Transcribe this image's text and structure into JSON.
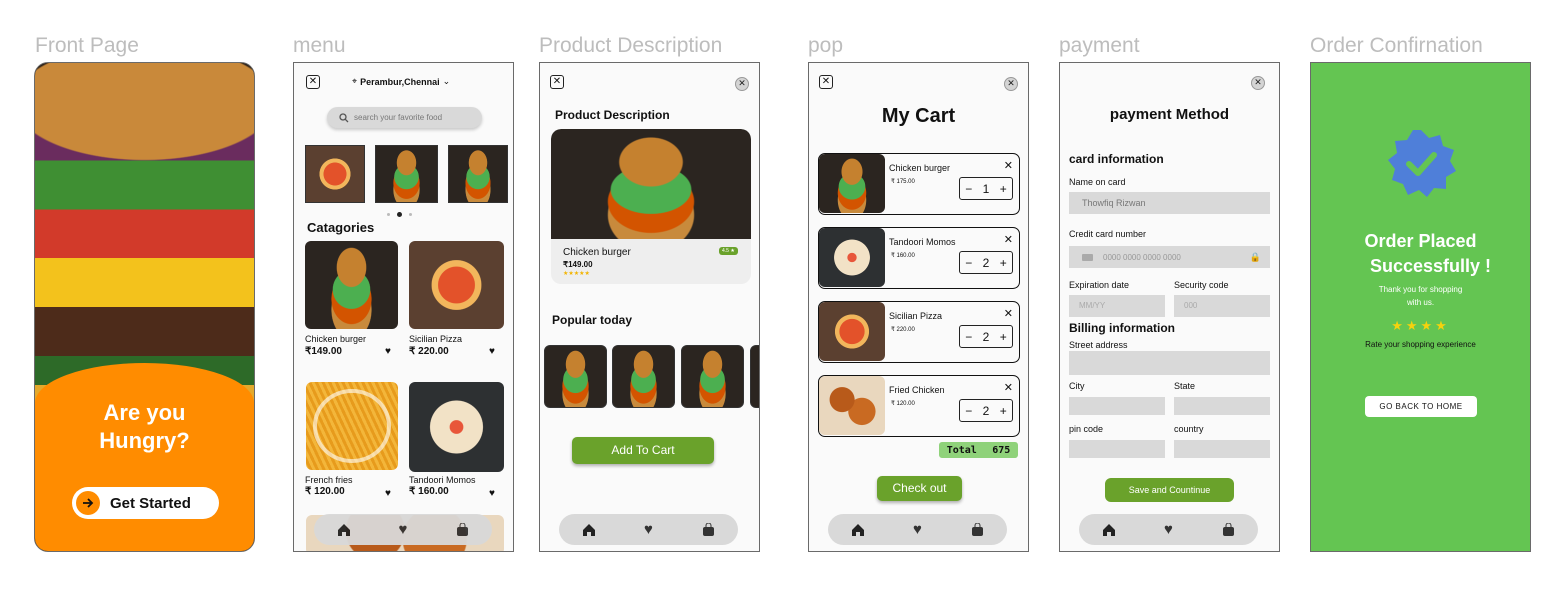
{
  "frames": {
    "front": "Front Page",
    "menu": "menu",
    "product": "Product Description",
    "pop": "pop",
    "payment": "payment",
    "order": "Order Confirnation"
  },
  "front_page": {
    "headline_line1": "Are you",
    "headline_line2": "Hungry?",
    "cta": "Get Started",
    "accent": "#ff8c00"
  },
  "menu": {
    "location": "Perambur,Chennai",
    "search_placeholder": "search your favorite food",
    "categories_title": "Catagories",
    "items": [
      {
        "name": "Chicken burger",
        "price": "₹149.00"
      },
      {
        "name": "Sicilian Pizza",
        "price": "₹ 220.00"
      },
      {
        "name": "French fries",
        "price": "₹ 120.00"
      },
      {
        "name": "Tandoori Momos",
        "price": "₹ 160.00"
      }
    ]
  },
  "product": {
    "title": "Product Description",
    "item_name": "Chicken burger",
    "item_price": "₹149.00",
    "rating_badge": "4.5 ★",
    "popular_title": "Popular today",
    "add_button": "Add To Cart",
    "accent": "#6aa22b"
  },
  "cart": {
    "title": "My Cart",
    "items": [
      {
        "name": "Chicken burger",
        "price": "₹ 175.00",
        "qty": "1"
      },
      {
        "name": "Tandoori Momos",
        "price": "₹ 160.00",
        "qty": "2"
      },
      {
        "name": "Sicilian Pizza",
        "price": "₹ 220.00",
        "qty": "2"
      },
      {
        "name": "Fried Chicken",
        "price": "₹ 120.00",
        "qty": "2"
      }
    ],
    "total_label": "Total",
    "total_value": "675",
    "checkout": "Check out"
  },
  "payment": {
    "title": "payment Method",
    "card_info": "card information",
    "name_label": "Name on card",
    "name_value": "Thowfiq Rizwan",
    "cc_label": "Credit card number",
    "cc_placeholder": "0000 0000 0000 0000",
    "exp_label": "Expiration date",
    "exp_placeholder": "MM/YY",
    "sec_label": "Security code",
    "sec_placeholder": "000",
    "billing": "Billing information",
    "street": "Street address",
    "city": "City",
    "state": "State",
    "pin": "pin code",
    "country": "country",
    "save": "Save and Countinue"
  },
  "order": {
    "line1": "Order Placed",
    "line2": "Successfully !",
    "thanks1": "Thank you for shopping",
    "thanks2": "with us.",
    "rate": "Rate your shopping experience",
    "back": "GO BACK TO HOME",
    "bg": "#64c552",
    "badge": "#4f7fd9"
  }
}
